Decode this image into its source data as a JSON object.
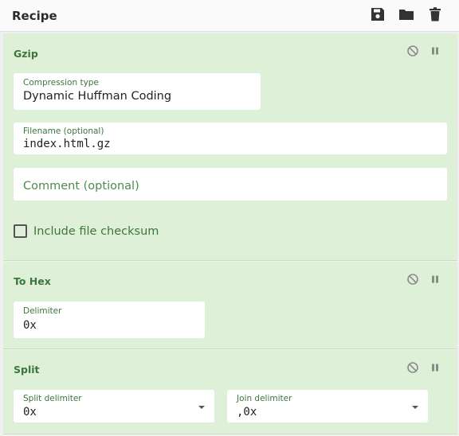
{
  "header": {
    "title": "Recipe",
    "icons": [
      "save-icon",
      "folder-icon",
      "trash-icon"
    ]
  },
  "colors": {
    "operation_background": "#dff0d8",
    "operation_title": "#3c763d",
    "header_background": "#fafafa"
  },
  "operations": [
    {
      "title": "Gzip",
      "compression_type": {
        "label": "Compression type",
        "value": "Dynamic Huffman Coding"
      },
      "filename": {
        "label": "Filename (optional)",
        "value": "index.html.gz"
      },
      "comment": {
        "placeholder": "Comment (optional)"
      },
      "checksum": {
        "label": "Include file checksum",
        "checked": false
      }
    },
    {
      "title": "To Hex",
      "delimiter": {
        "label": "Delimiter",
        "value": "0x"
      }
    },
    {
      "title": "Split",
      "split_delimiter": {
        "label": "Split delimiter",
        "value": "0x"
      },
      "join_delimiter": {
        "label": "Join delimiter",
        "value": ",0x"
      }
    }
  ]
}
